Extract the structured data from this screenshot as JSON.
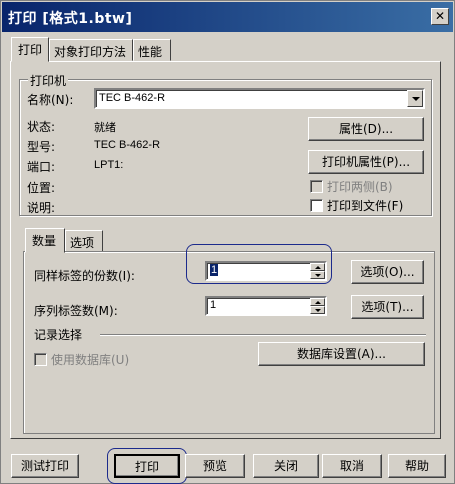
{
  "window": {
    "title": "打印 [格式1.btw]",
    "close_glyph": "✕"
  },
  "tabs": [
    {
      "label": "打印"
    },
    {
      "label": "对象打印方法"
    },
    {
      "label": "性能"
    }
  ],
  "printer_group": {
    "title": "打印机",
    "name_label": "名称(N):",
    "name_value": "TEC B-462-R",
    "status_label": "状态:",
    "status_value": "就绪",
    "model_label": "型号:",
    "model_value": "TEC B-462-R",
    "port_label": "端口:",
    "port_value": "LPT1:",
    "location_label": "位置:",
    "comment_label": "说明:",
    "properties_button": "属性(D)...",
    "printer_properties_button": "打印机属性(P)...",
    "duplex_label": "打印两侧(B)",
    "print_to_file_label": "打印到文件(F)"
  },
  "sub_tabs": [
    {
      "label": "数量"
    },
    {
      "label": "选项"
    }
  ],
  "quantity": {
    "copies_label": "同样标签的份数(I):",
    "copies_value": "1",
    "copies_options_button": "选项(O)...",
    "serial_label": "序列标签数(M):",
    "serial_value": "1",
    "serial_options_button": "选项(T)...",
    "record_selection_title": "记录选择",
    "use_database_label": "使用数据库(U)",
    "db_settings_button": "数据库设置(A)..."
  },
  "footer": {
    "test_print": "测试打印",
    "print": "打印",
    "preview": "预览",
    "close": "关闭",
    "cancel": "取消",
    "help": "帮助"
  }
}
